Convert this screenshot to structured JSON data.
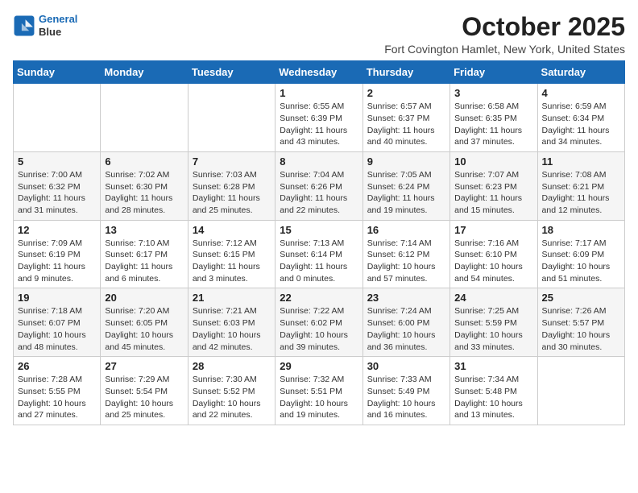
{
  "header": {
    "logo_line1": "General",
    "logo_line2": "Blue",
    "month": "October 2025",
    "location": "Fort Covington Hamlet, New York, United States"
  },
  "weekdays": [
    "Sunday",
    "Monday",
    "Tuesday",
    "Wednesday",
    "Thursday",
    "Friday",
    "Saturday"
  ],
  "weeks": [
    [
      {
        "day": "",
        "info": ""
      },
      {
        "day": "",
        "info": ""
      },
      {
        "day": "",
        "info": ""
      },
      {
        "day": "1",
        "info": "Sunrise: 6:55 AM\nSunset: 6:39 PM\nDaylight: 11 hours\nand 43 minutes."
      },
      {
        "day": "2",
        "info": "Sunrise: 6:57 AM\nSunset: 6:37 PM\nDaylight: 11 hours\nand 40 minutes."
      },
      {
        "day": "3",
        "info": "Sunrise: 6:58 AM\nSunset: 6:35 PM\nDaylight: 11 hours\nand 37 minutes."
      },
      {
        "day": "4",
        "info": "Sunrise: 6:59 AM\nSunset: 6:34 PM\nDaylight: 11 hours\nand 34 minutes."
      }
    ],
    [
      {
        "day": "5",
        "info": "Sunrise: 7:00 AM\nSunset: 6:32 PM\nDaylight: 11 hours\nand 31 minutes."
      },
      {
        "day": "6",
        "info": "Sunrise: 7:02 AM\nSunset: 6:30 PM\nDaylight: 11 hours\nand 28 minutes."
      },
      {
        "day": "7",
        "info": "Sunrise: 7:03 AM\nSunset: 6:28 PM\nDaylight: 11 hours\nand 25 minutes."
      },
      {
        "day": "8",
        "info": "Sunrise: 7:04 AM\nSunset: 6:26 PM\nDaylight: 11 hours\nand 22 minutes."
      },
      {
        "day": "9",
        "info": "Sunrise: 7:05 AM\nSunset: 6:24 PM\nDaylight: 11 hours\nand 19 minutes."
      },
      {
        "day": "10",
        "info": "Sunrise: 7:07 AM\nSunset: 6:23 PM\nDaylight: 11 hours\nand 15 minutes."
      },
      {
        "day": "11",
        "info": "Sunrise: 7:08 AM\nSunset: 6:21 PM\nDaylight: 11 hours\nand 12 minutes."
      }
    ],
    [
      {
        "day": "12",
        "info": "Sunrise: 7:09 AM\nSunset: 6:19 PM\nDaylight: 11 hours\nand 9 minutes."
      },
      {
        "day": "13",
        "info": "Sunrise: 7:10 AM\nSunset: 6:17 PM\nDaylight: 11 hours\nand 6 minutes."
      },
      {
        "day": "14",
        "info": "Sunrise: 7:12 AM\nSunset: 6:15 PM\nDaylight: 11 hours\nand 3 minutes."
      },
      {
        "day": "15",
        "info": "Sunrise: 7:13 AM\nSunset: 6:14 PM\nDaylight: 11 hours\nand 0 minutes."
      },
      {
        "day": "16",
        "info": "Sunrise: 7:14 AM\nSunset: 6:12 PM\nDaylight: 10 hours\nand 57 minutes."
      },
      {
        "day": "17",
        "info": "Sunrise: 7:16 AM\nSunset: 6:10 PM\nDaylight: 10 hours\nand 54 minutes."
      },
      {
        "day": "18",
        "info": "Sunrise: 7:17 AM\nSunset: 6:09 PM\nDaylight: 10 hours\nand 51 minutes."
      }
    ],
    [
      {
        "day": "19",
        "info": "Sunrise: 7:18 AM\nSunset: 6:07 PM\nDaylight: 10 hours\nand 48 minutes."
      },
      {
        "day": "20",
        "info": "Sunrise: 7:20 AM\nSunset: 6:05 PM\nDaylight: 10 hours\nand 45 minutes."
      },
      {
        "day": "21",
        "info": "Sunrise: 7:21 AM\nSunset: 6:03 PM\nDaylight: 10 hours\nand 42 minutes."
      },
      {
        "day": "22",
        "info": "Sunrise: 7:22 AM\nSunset: 6:02 PM\nDaylight: 10 hours\nand 39 minutes."
      },
      {
        "day": "23",
        "info": "Sunrise: 7:24 AM\nSunset: 6:00 PM\nDaylight: 10 hours\nand 36 minutes."
      },
      {
        "day": "24",
        "info": "Sunrise: 7:25 AM\nSunset: 5:59 PM\nDaylight: 10 hours\nand 33 minutes."
      },
      {
        "day": "25",
        "info": "Sunrise: 7:26 AM\nSunset: 5:57 PM\nDaylight: 10 hours\nand 30 minutes."
      }
    ],
    [
      {
        "day": "26",
        "info": "Sunrise: 7:28 AM\nSunset: 5:55 PM\nDaylight: 10 hours\nand 27 minutes."
      },
      {
        "day": "27",
        "info": "Sunrise: 7:29 AM\nSunset: 5:54 PM\nDaylight: 10 hours\nand 25 minutes."
      },
      {
        "day": "28",
        "info": "Sunrise: 7:30 AM\nSunset: 5:52 PM\nDaylight: 10 hours\nand 22 minutes."
      },
      {
        "day": "29",
        "info": "Sunrise: 7:32 AM\nSunset: 5:51 PM\nDaylight: 10 hours\nand 19 minutes."
      },
      {
        "day": "30",
        "info": "Sunrise: 7:33 AM\nSunset: 5:49 PM\nDaylight: 10 hours\nand 16 minutes."
      },
      {
        "day": "31",
        "info": "Sunrise: 7:34 AM\nSunset: 5:48 PM\nDaylight: 10 hours\nand 13 minutes."
      },
      {
        "day": "",
        "info": ""
      }
    ]
  ]
}
